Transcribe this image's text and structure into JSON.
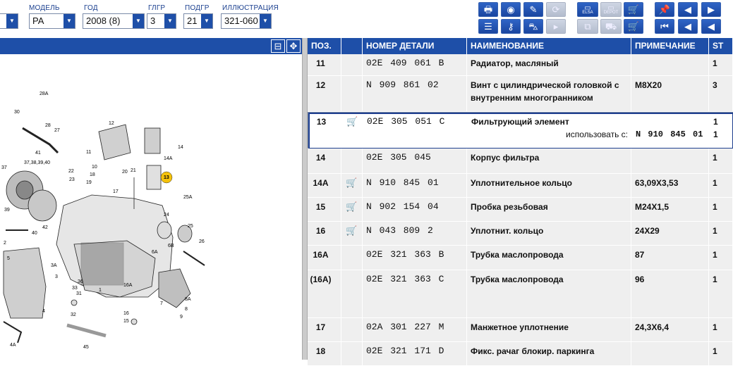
{
  "filters": {
    "fields": [
      {
        "label": "МОДЕЛЬ",
        "value": "PA"
      },
      {
        "label": "ГОД",
        "value": "2008 (8)"
      },
      {
        "label": "ГЛГР",
        "value": "3"
      },
      {
        "label": "ПОДГР",
        "value": "21"
      },
      {
        "label": "ИЛЛЮСТРАЦИЯ",
        "value": "321-060"
      }
    ]
  },
  "toolbar": {
    "elsa_label": "ELSA",
    "depot_label": "DEPOT"
  },
  "illustration": {
    "labels": [
      "28A",
      "30",
      "28",
      "27",
      "41",
      "37,38,39,40",
      "37",
      "39",
      "42",
      "40",
      "5",
      "3A",
      "3",
      "4",
      "4A",
      "45",
      "32",
      "33",
      "31",
      "36",
      "1",
      "12",
      "11",
      "10",
      "14A",
      "14",
      "13",
      "22",
      "23",
      "18",
      "19",
      "20",
      "21",
      "17",
      "16A",
      "16",
      "15",
      "25A",
      "24",
      "25",
      "26",
      "6B",
      "6A",
      "7",
      "9",
      "8",
      "2",
      "8A"
    ],
    "highlight": "13"
  },
  "columns": {
    "pos": "ПОЗ.",
    "part": "НОМЕР ДЕТАЛИ",
    "name": "НАИМЕНОВАНИЕ",
    "note": "ПРИМЕЧАНИЕ",
    "st": "ST"
  },
  "rows": [
    {
      "pos": "11",
      "cart": false,
      "part": "02E 409 061 B",
      "name": "Радиатор, масляный",
      "note": "",
      "st": "1"
    },
    {
      "pos": "12",
      "cart": false,
      "part": "N  909 861 02",
      "name": "Винт с цилиндрической головкой с внутренним многогранником",
      "note": "M8X20",
      "st": "3"
    },
    {
      "pos": "13",
      "cart": true,
      "part": "02E 305 051 C",
      "name": "Фильтрующий элемент",
      "use_label": "использовать с:",
      "use_part": "N  910 845 01",
      "note": "",
      "st": "1",
      "st2": "1",
      "selected": true
    },
    {
      "pos": "14",
      "cart": false,
      "part": "02E 305 045",
      "name": "Корпус фильтра",
      "note": "",
      "st": "1"
    },
    {
      "pos": "14A",
      "cart": true,
      "part": "N  910 845 01",
      "name": "Уплотнительное кольцо",
      "note": "63,09X3,53",
      "st": "1"
    },
    {
      "pos": "15",
      "cart": true,
      "part": "N  902 154 04",
      "name": "Пробка резьбовая",
      "note": "M24X1,5",
      "st": "1"
    },
    {
      "pos": "16",
      "cart": true,
      "part": "N  043 809 2",
      "name": "Уплотнит. кольцо",
      "note": "24X29",
      "st": "1"
    },
    {
      "pos": "16A",
      "cart": false,
      "part": "02E 321 363 B",
      "name": "Трубка маслопровода",
      "note": "87",
      "st": "1"
    },
    {
      "pos": "(16A)",
      "cart": false,
      "part": "02E 321 363 C",
      "name": "Трубка маслопровода",
      "note": "96",
      "st": "1"
    },
    {
      "pos": "17",
      "cart": false,
      "part": "02A 301 227 M",
      "name": "Манжетное уплотнение",
      "note": "24,3X6,4",
      "st": "1"
    },
    {
      "pos": "18",
      "cart": false,
      "part": "02E 321 171 D",
      "name": "Фикс. рачаг блокир. паркинга",
      "note": "",
      "st": "1"
    }
  ]
}
